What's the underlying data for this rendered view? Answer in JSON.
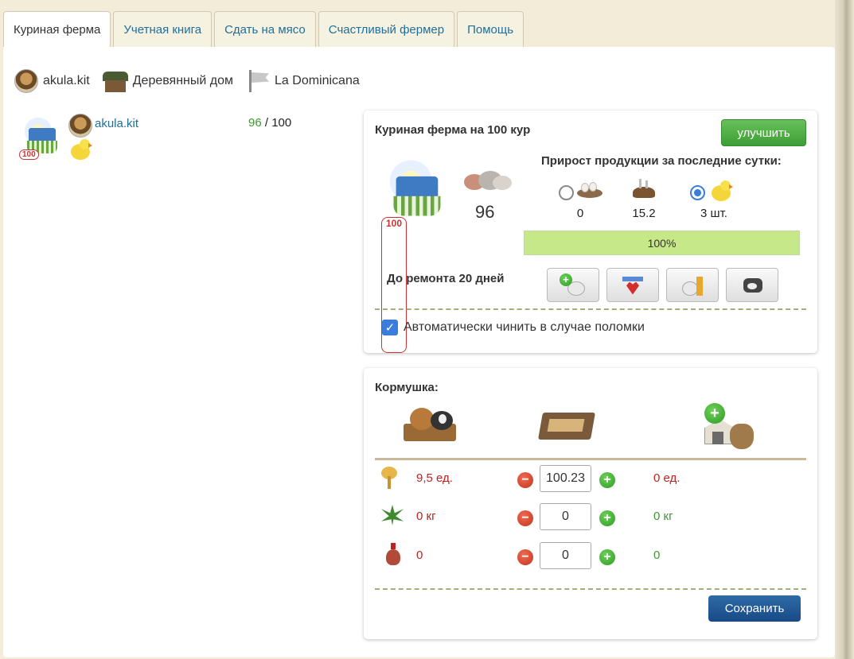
{
  "tabs": [
    {
      "label": "Куриная ферма",
      "active": true
    },
    {
      "label": "Учетная книга",
      "active": false
    },
    {
      "label": "Сдать на мясо",
      "active": false
    },
    {
      "label": "Счастливый фермер",
      "active": false
    },
    {
      "label": "Помощь",
      "active": false
    }
  ],
  "infobar": {
    "user": "akula.kit",
    "house": "Деревянный дом",
    "country": "La Dominicana"
  },
  "farm_list": [
    {
      "owner": "akula.kit",
      "count": "96",
      "capacity": "/ 100",
      "badge": "100"
    }
  ],
  "farm_panel": {
    "title": "Куриная ферма на 100 кур",
    "upgrade_label": "улучшить",
    "badge": "100",
    "hens": "96",
    "growth_title": "Прирост продукции за последние сутки:",
    "products": [
      {
        "value": "0",
        "icon": "eggs-icon",
        "selected": false,
        "has_radio": true
      },
      {
        "value": "15.2",
        "icon": "manure-icon",
        "selected": false,
        "has_radio": false
      },
      {
        "value": "3 шт.",
        "icon": "chick-icon",
        "selected": true,
        "has_radio": true
      }
    ],
    "progress_label": "100%",
    "progress": 1.0,
    "repair_label": "До ремонта 20 дней",
    "tool_buttons": [
      "add-hen-icon",
      "vet-icon",
      "feed-hen-icon",
      "repair-icon"
    ],
    "auto_repair_label": "Автоматически чинить в случае поломки",
    "auto_repair_checked": true
  },
  "feeder": {
    "title": "Кормушка:",
    "column_icons": [
      "hens-feeding-icon",
      "feeder-trough-icon",
      "warehouse-add-icon"
    ],
    "rows": [
      {
        "icon": "grain-icon",
        "per_day": "9,5 ед.",
        "input": "100.23",
        "stock": "0 ед.",
        "stock_color": "red"
      },
      {
        "icon": "herb-icon",
        "per_day": "0 кг",
        "input": "0",
        "stock": "0 кг",
        "stock_color": "green"
      },
      {
        "icon": "potion-icon",
        "per_day": "0",
        "input": "0",
        "stock": "0",
        "stock_color": "green"
      }
    ],
    "save_label": "Сохранить"
  },
  "colors": {
    "accent_green": "#4aa83f",
    "accent_blue": "#1f4f8a",
    "link": "#1f6f9a",
    "red_value": "#c0221f",
    "green_value": "#3c9a2f",
    "progress_fill": "#c7e888"
  }
}
